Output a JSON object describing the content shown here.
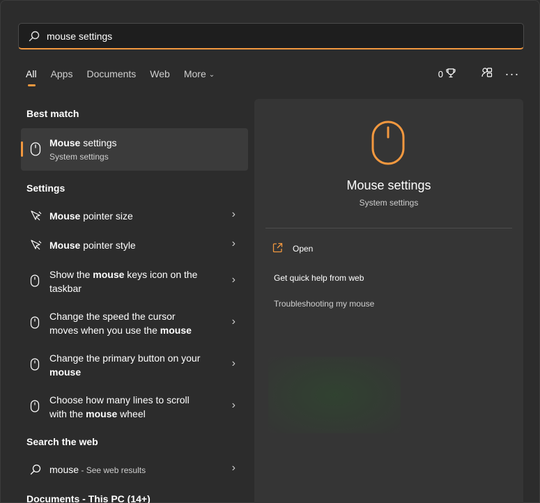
{
  "search": {
    "value": "mouse settings",
    "placeholder": ""
  },
  "tabs": [
    {
      "label": "All",
      "active": true
    },
    {
      "label": "Apps"
    },
    {
      "label": "Documents"
    },
    {
      "label": "Web"
    },
    {
      "label": "More"
    }
  ],
  "top_right": {
    "points": "0"
  },
  "sections": {
    "best_match": "Best match",
    "settings": "Settings",
    "search_web": "Search the web",
    "documents": "Documents - This PC (14+)"
  },
  "best_match": {
    "title_bold": "Mouse",
    "title_rest": " settings",
    "subtitle": "System settings"
  },
  "settings_items": [
    {
      "pre": "",
      "bold": "Mouse",
      "post": " pointer size"
    },
    {
      "pre": "",
      "bold": "Mouse",
      "post": " pointer style"
    },
    {
      "pre": "Show the ",
      "bold": "mouse",
      "post": " keys icon on the taskbar"
    },
    {
      "pre": "Change the speed the cursor moves when you use the ",
      "bold": "mouse",
      "post": ""
    },
    {
      "pre": "Change the primary button on your ",
      "bold": "mouse",
      "post": ""
    },
    {
      "pre": "Choose how many lines to scroll with the ",
      "bold": "mouse",
      "post": " wheel"
    }
  ],
  "web_item": {
    "query": "mouse",
    "suffix": " - See web results"
  },
  "panel": {
    "title": "Mouse settings",
    "subtitle": "System settings",
    "open": "Open",
    "quick_help": "Get quick help from web",
    "troubleshoot": "Troubleshooting my mouse"
  },
  "colors": {
    "accent": "#f2983f",
    "panel": "#353535",
    "background": "#2c2c2c"
  }
}
